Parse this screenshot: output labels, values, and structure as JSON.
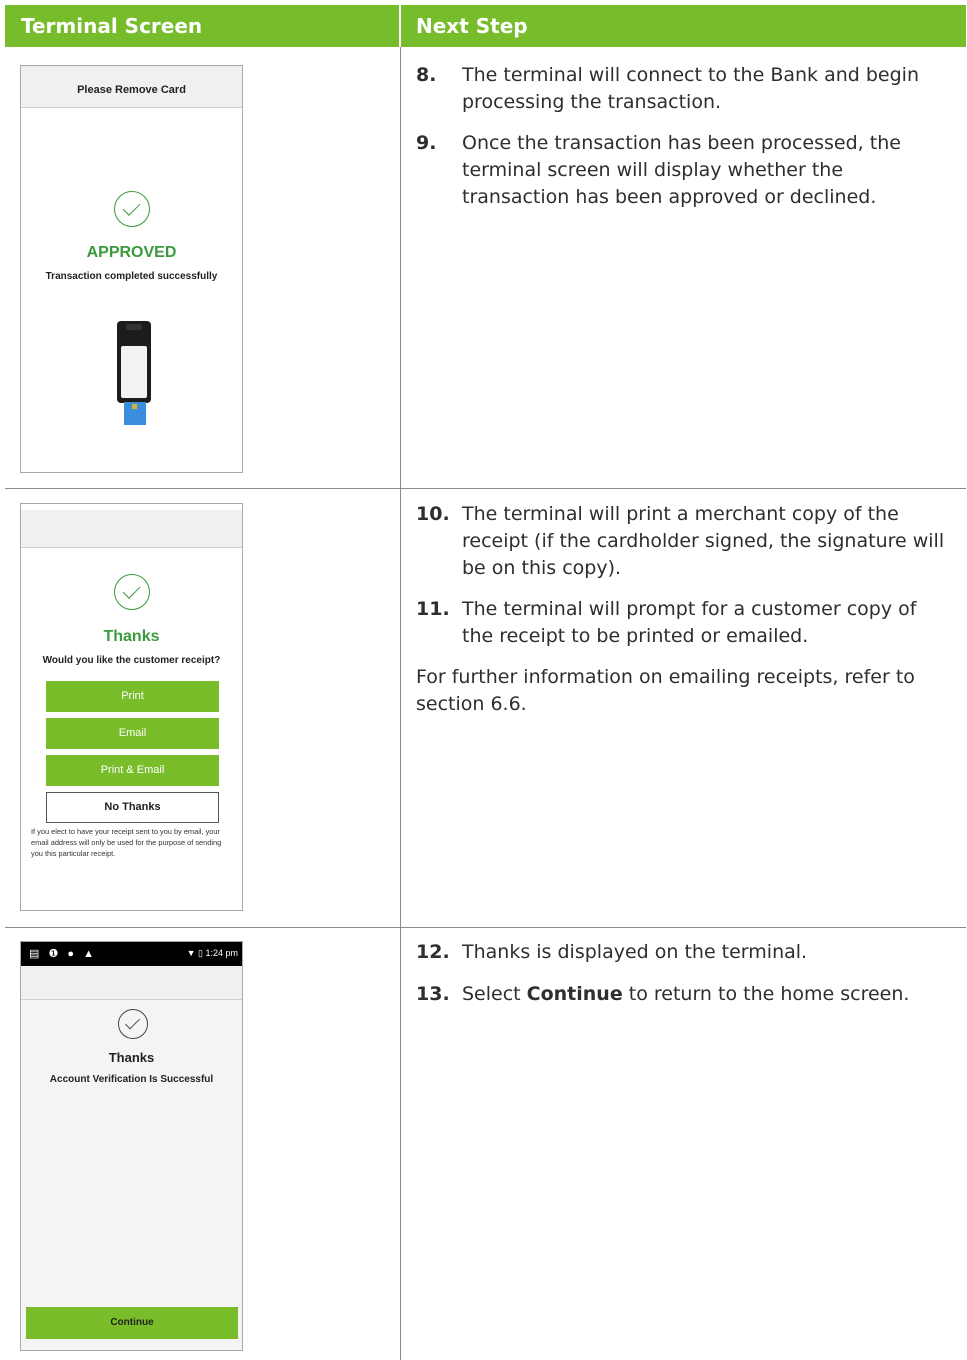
{
  "header": {
    "left": "Terminal Screen",
    "right": "Next Step"
  },
  "colors": {
    "accent": "#77bc2a",
    "success_green": "#3a9a3c"
  },
  "screen1": {
    "top_bar": "Please Remove Card",
    "status_title": "APPROVED",
    "status_message": "Transaction completed successfully",
    "icons": [
      "check-circle-icon",
      "payment-terminal-illustration",
      "card-icon"
    ]
  },
  "screen2": {
    "title": "Thanks",
    "question": "Would you like the customer receipt?",
    "buttons": {
      "print": "Print",
      "email": "Email",
      "print_email": "Print & Email",
      "no_thanks": "No Thanks"
    },
    "fine_print": "If you elect to have your receipt sent to you by email, your email address will only be used for the purpose of sending you this particular receipt."
  },
  "screen3": {
    "status_icons": "▤ ❶ ● ▲",
    "status_right": "▼ ▯ 1:24 pm",
    "title": "Thanks",
    "message": "Account Verification Is Successful",
    "continue": "Continue"
  },
  "steps": [
    {
      "num": "8.",
      "pre": "The terminal will connect to the Bank and begin processing the transaction."
    },
    {
      "num": "9.",
      "pre": "Once the transaction has been processed, the terminal screen will display whether the transaction has been approved or declined."
    },
    {
      "num": "10.",
      "pre": "The terminal will print a merchant copy of the receipt (if the cardholder signed, the signature will be on this copy)."
    },
    {
      "num": "11.",
      "pre": "The terminal will prompt for a customer copy of the receipt to be printed or emailed."
    },
    {
      "num": "12.",
      "pre": "Thanks is displayed on the terminal."
    },
    {
      "num": "13.",
      "pre": "Select ",
      "bold": "Continue",
      "post": " to return to the home screen."
    }
  ],
  "note": "For further information on emailing receipts, refer to section 6.6."
}
